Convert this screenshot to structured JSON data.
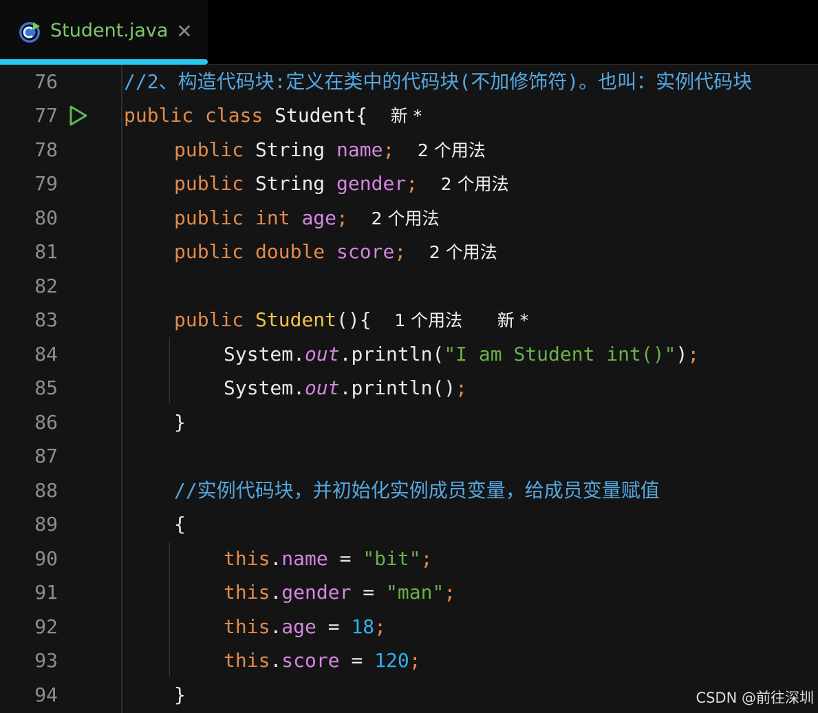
{
  "tab": {
    "title": "Student.java",
    "close": "✕",
    "icon": "java-class-icon"
  },
  "gutter": {
    "line_numbers": [
      "76",
      "77",
      "78",
      "79",
      "80",
      "81",
      "82",
      "83",
      "84",
      "85",
      "86",
      "87",
      "88",
      "89",
      "90",
      "91",
      "92",
      "93",
      "94"
    ],
    "run_icon": "run-gutter-icon"
  },
  "code": {
    "l76": {
      "comment": "//2、构造代码块:定义在类中的代码块(不加修饰符)。也叫：实例代码块"
    },
    "l77": {
      "kw1": "public",
      "kw2": "class",
      "name": "Student{",
      "hint": "新 *"
    },
    "l78": {
      "kw": "public",
      "type": "String",
      "field": "name",
      "semi": ";",
      "hint": "2 个用法"
    },
    "l79": {
      "kw": "public",
      "type": "String",
      "field": "gender",
      "semi": ";",
      "hint": "2 个用法"
    },
    "l80": {
      "kw": "public",
      "type": "int",
      "field": "age",
      "semi": ";",
      "hint": "2 个用法"
    },
    "l81": {
      "kw": "public",
      "type": "double",
      "field": "score",
      "semi": ";",
      "hint": "2 个用法"
    },
    "l83": {
      "kw": "public",
      "ctor": "Student",
      "rest": "(){",
      "hint1": "1 个用法",
      "hint2": "新 *"
    },
    "l84": {
      "sys": "System.",
      "out": "out",
      "call": ".println(",
      "str": "\"I am Student int()\"",
      "close": ")",
      "semi": ";"
    },
    "l85": {
      "sys": "System.",
      "out": "out",
      "call": ".println()",
      "semi": ";"
    },
    "l86": {
      "brace": "}"
    },
    "l88": {
      "comment": "//实例代码块，并初始化实例成员变量，给成员变量赋值"
    },
    "l89": {
      "brace": "{"
    },
    "l90": {
      "this": "this",
      "dot": ".",
      "field": "name",
      "eq": " = ",
      "val": "\"bit\"",
      "semi": ";"
    },
    "l91": {
      "this": "this",
      "dot": ".",
      "field": "gender",
      "eq": " = ",
      "val": "\"man\"",
      "semi": ";"
    },
    "l92": {
      "this": "this",
      "dot": ".",
      "field": "age",
      "eq": " = ",
      "val": "18",
      "semi": ";"
    },
    "l93": {
      "this": "this",
      "dot": ".",
      "field": "score",
      "eq": " = ",
      "val": "120",
      "semi": ";"
    },
    "l94": {
      "brace": "}"
    }
  },
  "watermark": "CSDN @前往深圳",
  "colors": {
    "background": "#141414",
    "keyword": "#e38a4b",
    "field": "#d486e0",
    "string": "#6ab04c",
    "number": "#2db1ee",
    "comment": "#55a7e0",
    "constructor": "#f2c34a",
    "tab_accent": "#27c8ee",
    "tab_title": "#7ec86a"
  }
}
